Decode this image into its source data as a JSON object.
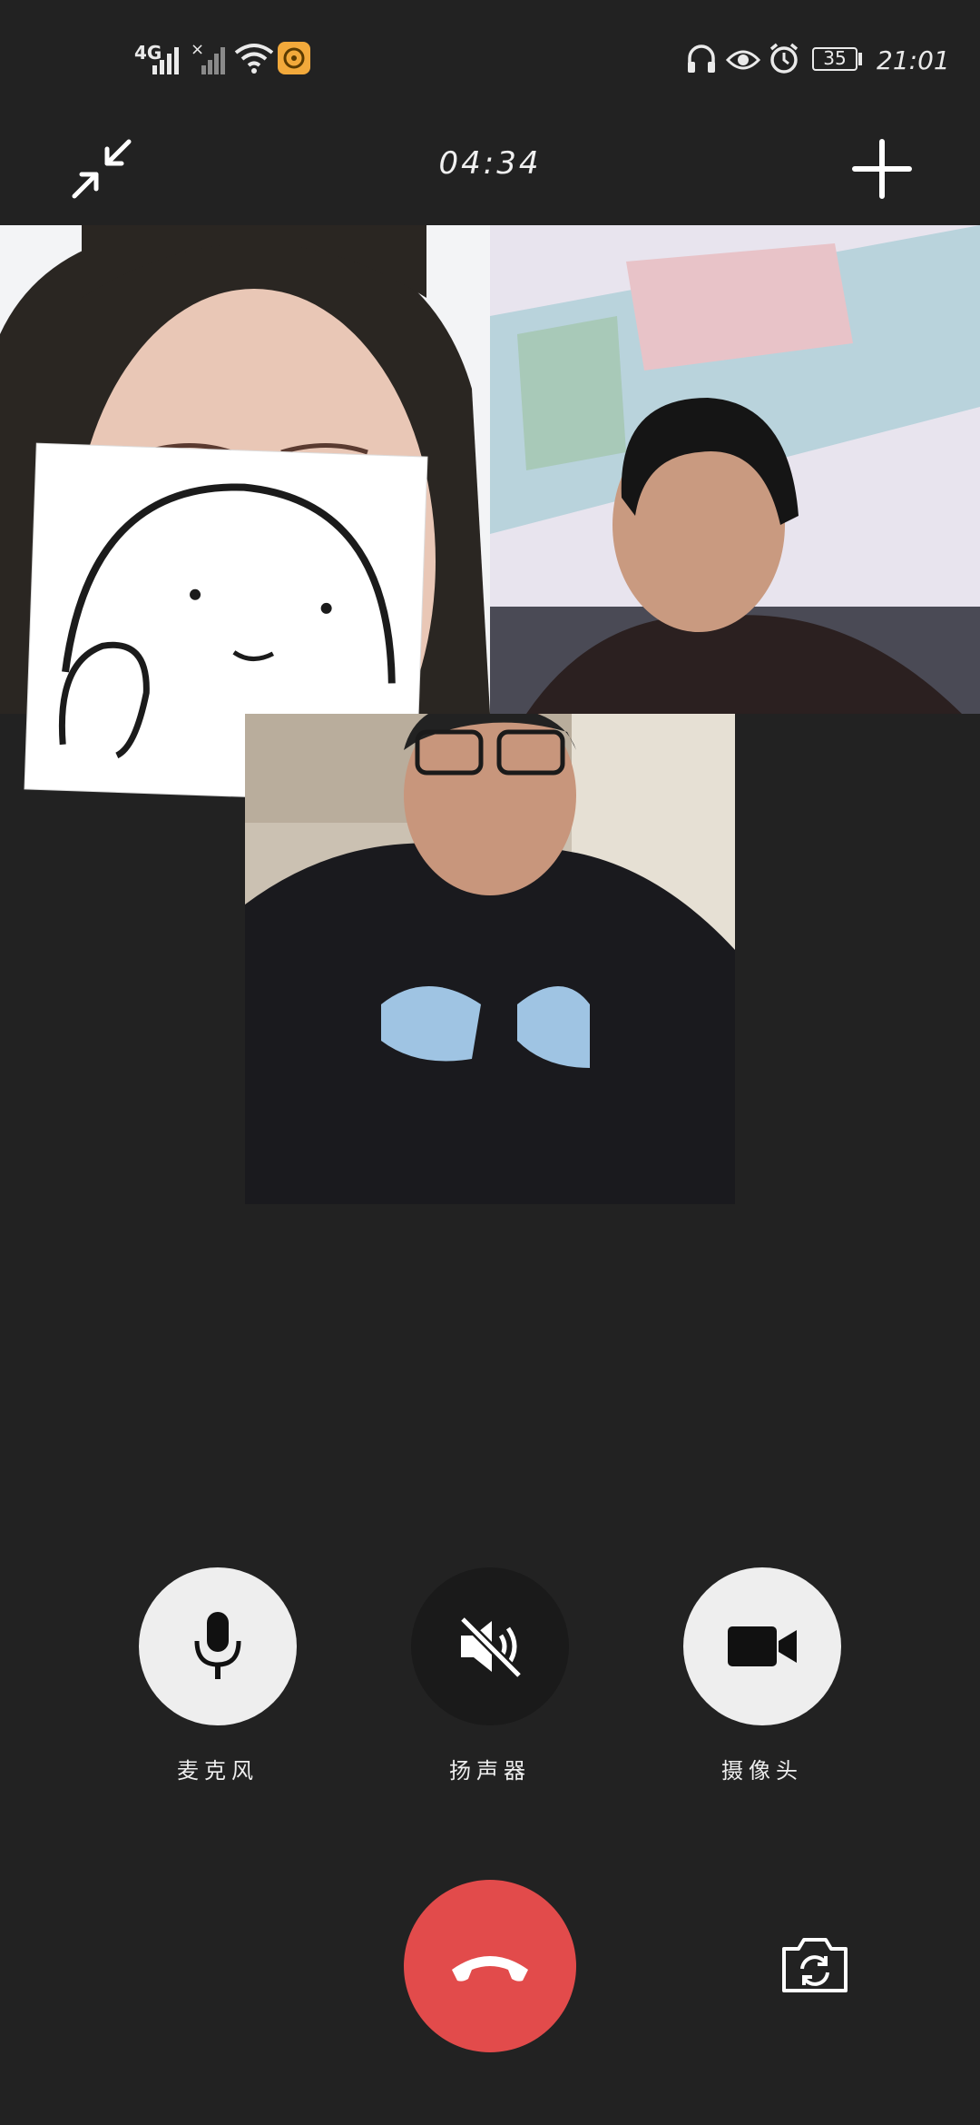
{
  "status_bar": {
    "network_label": "4G",
    "battery_level": "35",
    "time": "21:01"
  },
  "top_bar": {
    "call_duration": "04:34"
  },
  "controls": {
    "microphone_label": "麦克风",
    "speaker_label": "扬声器",
    "camera_label": "摄像头"
  },
  "colors": {
    "background": "#222222",
    "button_light": "#eeeeee",
    "button_dark": "#1a1a1a",
    "hangup": "#e24b4b"
  }
}
